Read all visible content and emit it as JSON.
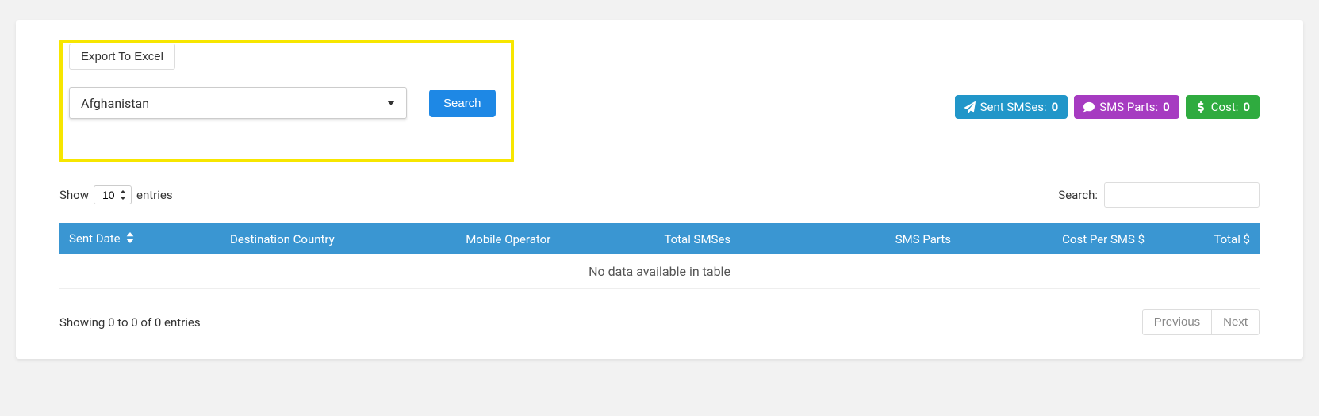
{
  "controls": {
    "export_label": "Export To Excel",
    "country_selected": "Afghanistan",
    "search_button": "Search"
  },
  "badges": {
    "sent_smses": {
      "label": "Sent SMSes:",
      "value": "0"
    },
    "sms_parts": {
      "label": "SMS Parts:",
      "value": "0"
    },
    "cost": {
      "label": "Cost:",
      "value": "0"
    }
  },
  "datatable": {
    "show_label_prefix": "Show",
    "show_label_suffix": "entries",
    "page_length": "10",
    "search_label": "Search:",
    "columns": {
      "sent_date": "Sent Date",
      "destination_country": "Destination Country",
      "mobile_operator": "Mobile Operator",
      "total_smses": "Total SMSes",
      "sms_parts": "SMS Parts",
      "cost_per_sms": "Cost Per SMS $",
      "total": "Total $"
    },
    "empty_text": "No data available in table",
    "info_text": "Showing 0 to 0 of 0 entries",
    "previous": "Previous",
    "next": "Next"
  }
}
